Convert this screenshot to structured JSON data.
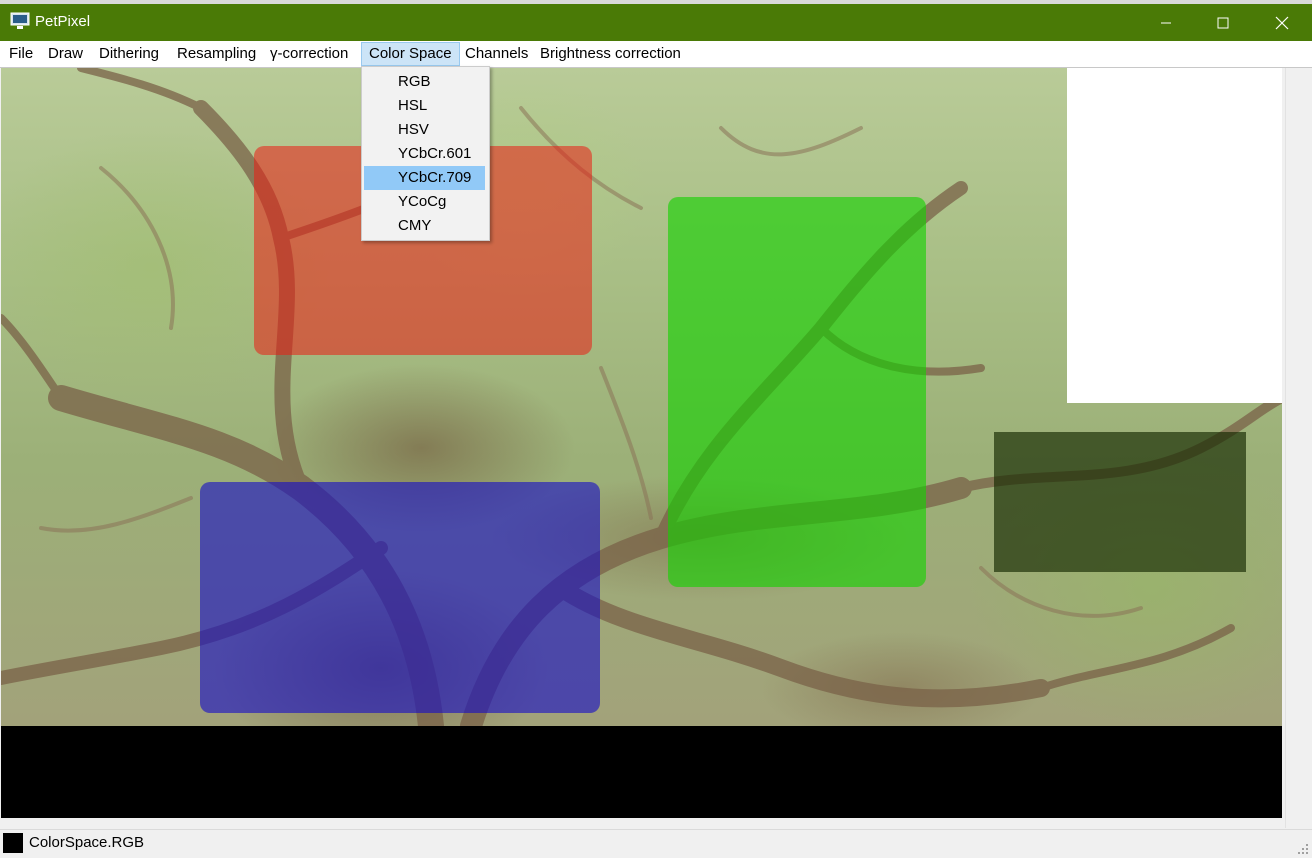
{
  "window": {
    "title": "PetPixel",
    "controls": {
      "minimize_icon": "minimize-icon",
      "maximize_icon": "maximize-icon",
      "close_icon": "close-icon"
    },
    "titlebar_color": "#4a7a06"
  },
  "menubar": {
    "items": [
      {
        "label": "File"
      },
      {
        "label": "Draw"
      },
      {
        "label": "Dithering"
      },
      {
        "label": "Resampling"
      },
      {
        "label": "γ-correction"
      },
      {
        "label": "Color Space",
        "active": true
      },
      {
        "label": "Channels"
      },
      {
        "label": "Brightness correction"
      }
    ]
  },
  "color_space_menu": {
    "items": [
      {
        "label": "RGB"
      },
      {
        "label": "HSL"
      },
      {
        "label": "HSV"
      },
      {
        "label": "YCbCr.601"
      },
      {
        "label": "YCbCr.709",
        "highlighted": true
      },
      {
        "label": "YCoCg"
      },
      {
        "label": "CMY"
      }
    ],
    "highlight_color": "#91c9f7"
  },
  "canvas": {
    "overlays": [
      {
        "name": "red-rectangle",
        "color": "#eb1e14"
      },
      {
        "name": "green-rectangle",
        "color": "#14d200"
      },
      {
        "name": "blue-rectangle",
        "color": "#140ac8"
      },
      {
        "name": "dark-rectangle",
        "color": "#142800"
      }
    ]
  },
  "statusbar": {
    "color_swatch": "#000000",
    "text": "ColorSpace.RGB"
  }
}
